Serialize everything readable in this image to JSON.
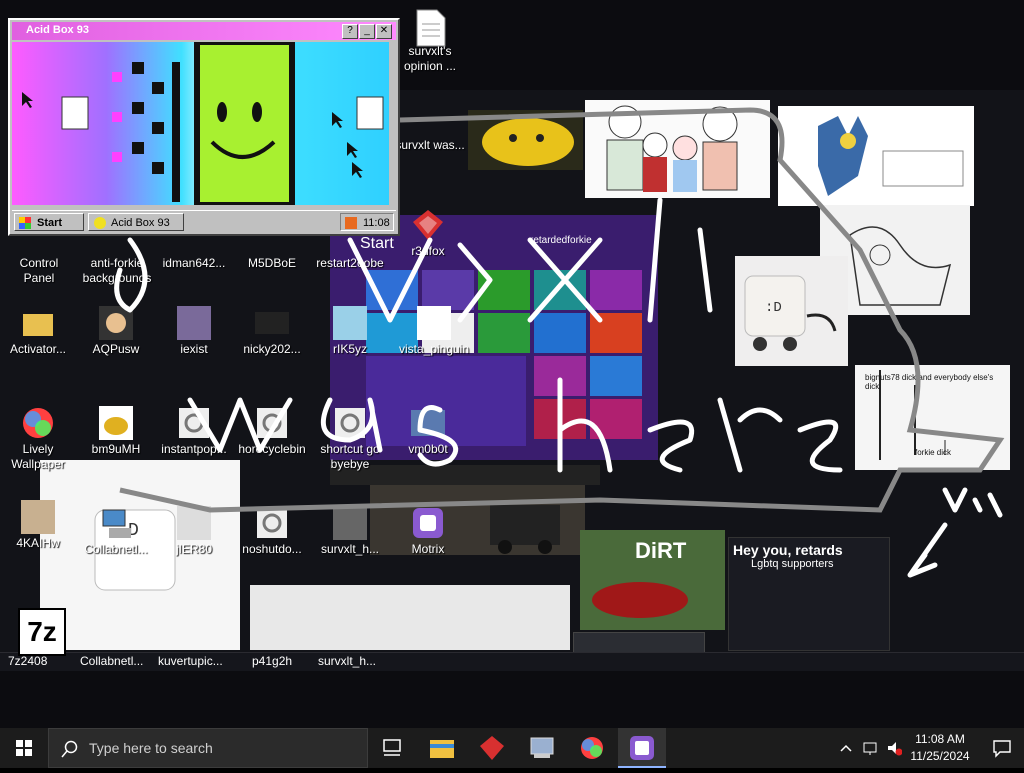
{
  "acid_window": {
    "title": "Acid Box 93",
    "start_label": "Start",
    "task_label": "Acid Box 93",
    "time": "11:08"
  },
  "desktop_icons": [
    {
      "label": "survxlt's\nopinion ..."
    },
    {
      "label": "survxlt was..."
    },
    {
      "label": "Control\nPanel"
    },
    {
      "label": "anti-forkie\nbackgrounds"
    },
    {
      "label": "idman642..."
    },
    {
      "label": "M5DBoE"
    },
    {
      "label": "restart2oobe"
    },
    {
      "label": "r3dfox"
    },
    {
      "label": "Activator..."
    },
    {
      "label": "AQPusw"
    },
    {
      "label": "iexist"
    },
    {
      "label": "nicky202..."
    },
    {
      "label": "rIK5yz"
    },
    {
      "label": "vista_pinguin"
    },
    {
      "label": "Lively\nWallpaper"
    },
    {
      "label": "bm9uMH"
    },
    {
      "label": "instantpop..."
    },
    {
      "label": "horecyclebin"
    },
    {
      "label": "shortcut go\nbyebye"
    },
    {
      "label": "vm0b0t"
    },
    {
      "label": "4KAIHw"
    },
    {
      "label": "Collabnetl..."
    },
    {
      "label": "jIER80"
    },
    {
      "label": "noshutdo..."
    },
    {
      "label": "survxlt_h..."
    },
    {
      "label": "Motrix"
    }
  ],
  "overlay_text": {
    "hey_title": "Hey you, retards",
    "hey_sub": "Lgbtq supporters",
    "stick_caption": "bignuts78 dick and everybody else's dick",
    "stick_caption2": "forkie dick",
    "start_tile": "Start",
    "retarded": "retardedforkie"
  },
  "inner_taskbar": [
    {
      "label": "7z2408"
    },
    {
      "label": "Collabnetl..."
    },
    {
      "label": "kuvertupic..."
    },
    {
      "label": "p41g2h"
    },
    {
      "label": "survxlt_h..."
    }
  ],
  "taskbar": {
    "search_placeholder": "Type here to search",
    "time": "11:08 AM",
    "date": "11/25/2024",
    "apps": [
      "task-view-icon",
      "file-explorer-icon",
      "r3dfox-icon",
      "control-panel-icon",
      "lively-wallpaper-icon",
      "motrix-icon"
    ]
  },
  "colors": {
    "accent": "#8fb4ff",
    "acid_title": "#e060e0",
    "taskbar": "#1c1c1c"
  }
}
